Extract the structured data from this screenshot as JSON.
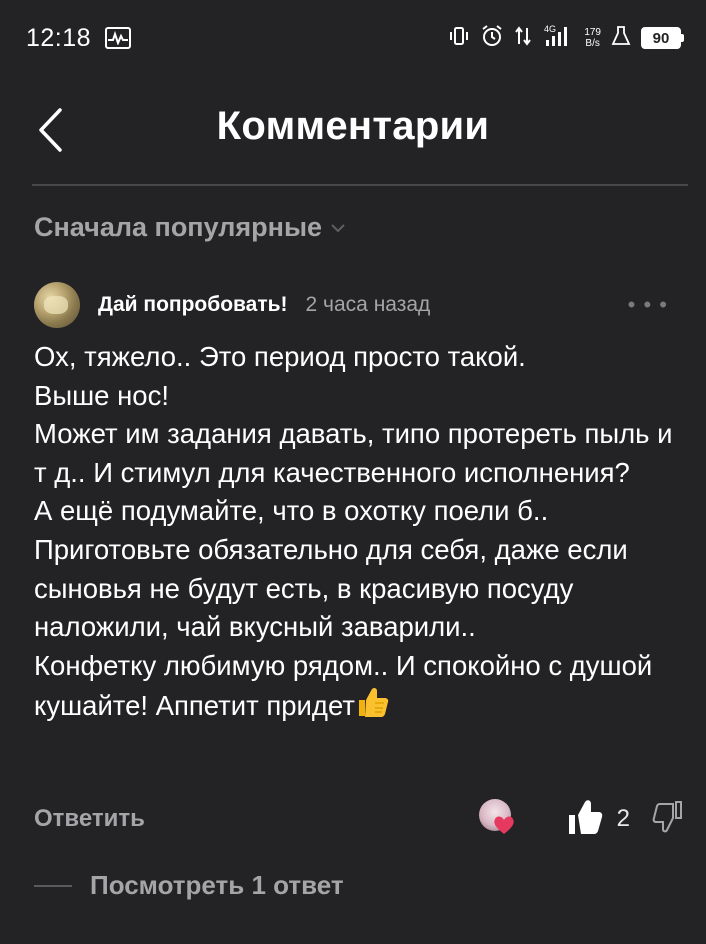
{
  "status_bar": {
    "time": "12:18",
    "network": "4G",
    "speed_value": "179",
    "speed_unit": "B/s",
    "battery": "90"
  },
  "header": {
    "title": "Комментарии"
  },
  "sort": {
    "label": "Сначала популярные"
  },
  "comment": {
    "author": "Дай попробовать!",
    "time": "2 часа назад",
    "text": "Ох, тяжело.. Это период просто такой.\nВыше нос!\nМожет им задания давать, типо протереть пыль и т д.. И стимул для качественного исполнения?\nА ещё подумайте, что в охотку поели б..\nПриготовьте обязательно для себя, даже если сыновья не будут есть, в красивую посуду наложили, чай вкусный заварили..\nКонфетку любимую рядом.. И спокойно с душой кушайте! Аппетит придет",
    "reply_label": "Ответить",
    "like_count": "2",
    "view_replies_label": "Посмотреть 1 ответ"
  },
  "colors": {
    "background": "#232325",
    "text_primary": "#ffffff",
    "text_secondary": "#a5a5a8",
    "divider": "#48484b"
  }
}
